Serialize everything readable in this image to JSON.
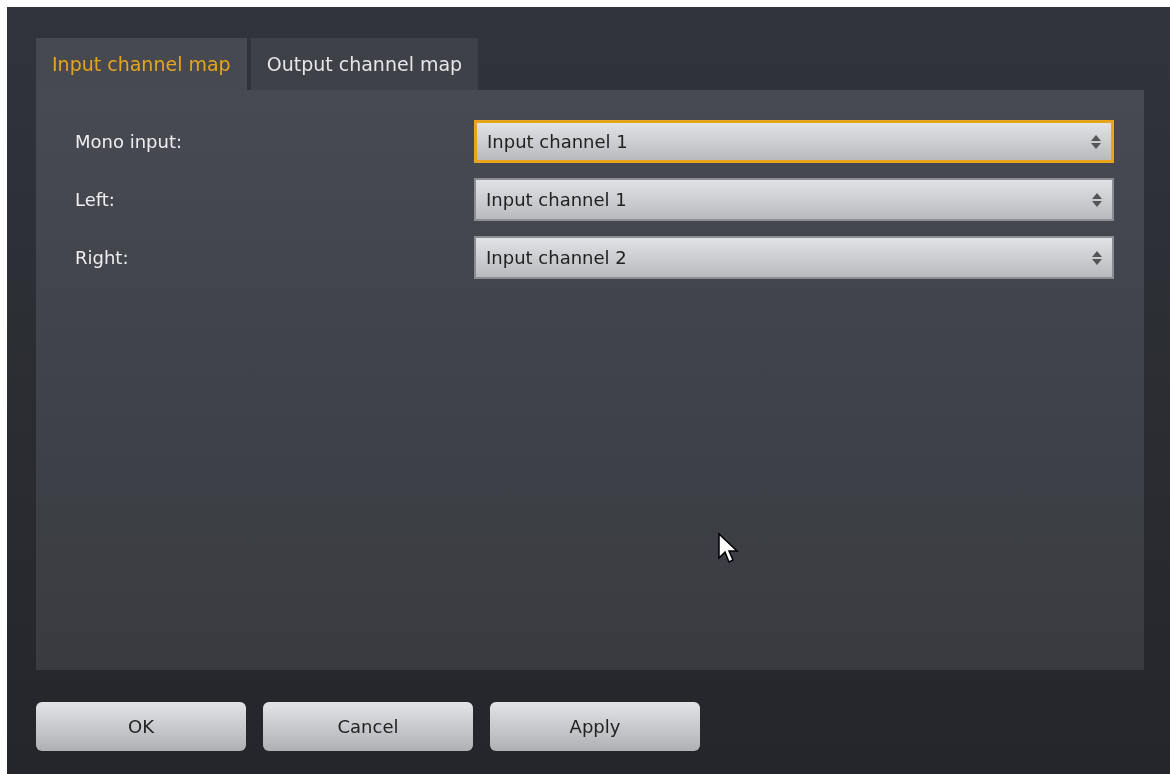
{
  "tabs": [
    {
      "label": "Input channel map",
      "selected": true
    },
    {
      "label": "Output channel map",
      "selected": false
    }
  ],
  "fields": [
    {
      "label": "Mono input:",
      "value": "Input channel 1",
      "focused": true
    },
    {
      "label": "Left:",
      "value": "Input channel 1",
      "focused": false
    },
    {
      "label": "Right:",
      "value": "Input channel 2",
      "focused": false
    }
  ],
  "buttons": [
    "OK",
    "Cancel",
    "Apply"
  ]
}
